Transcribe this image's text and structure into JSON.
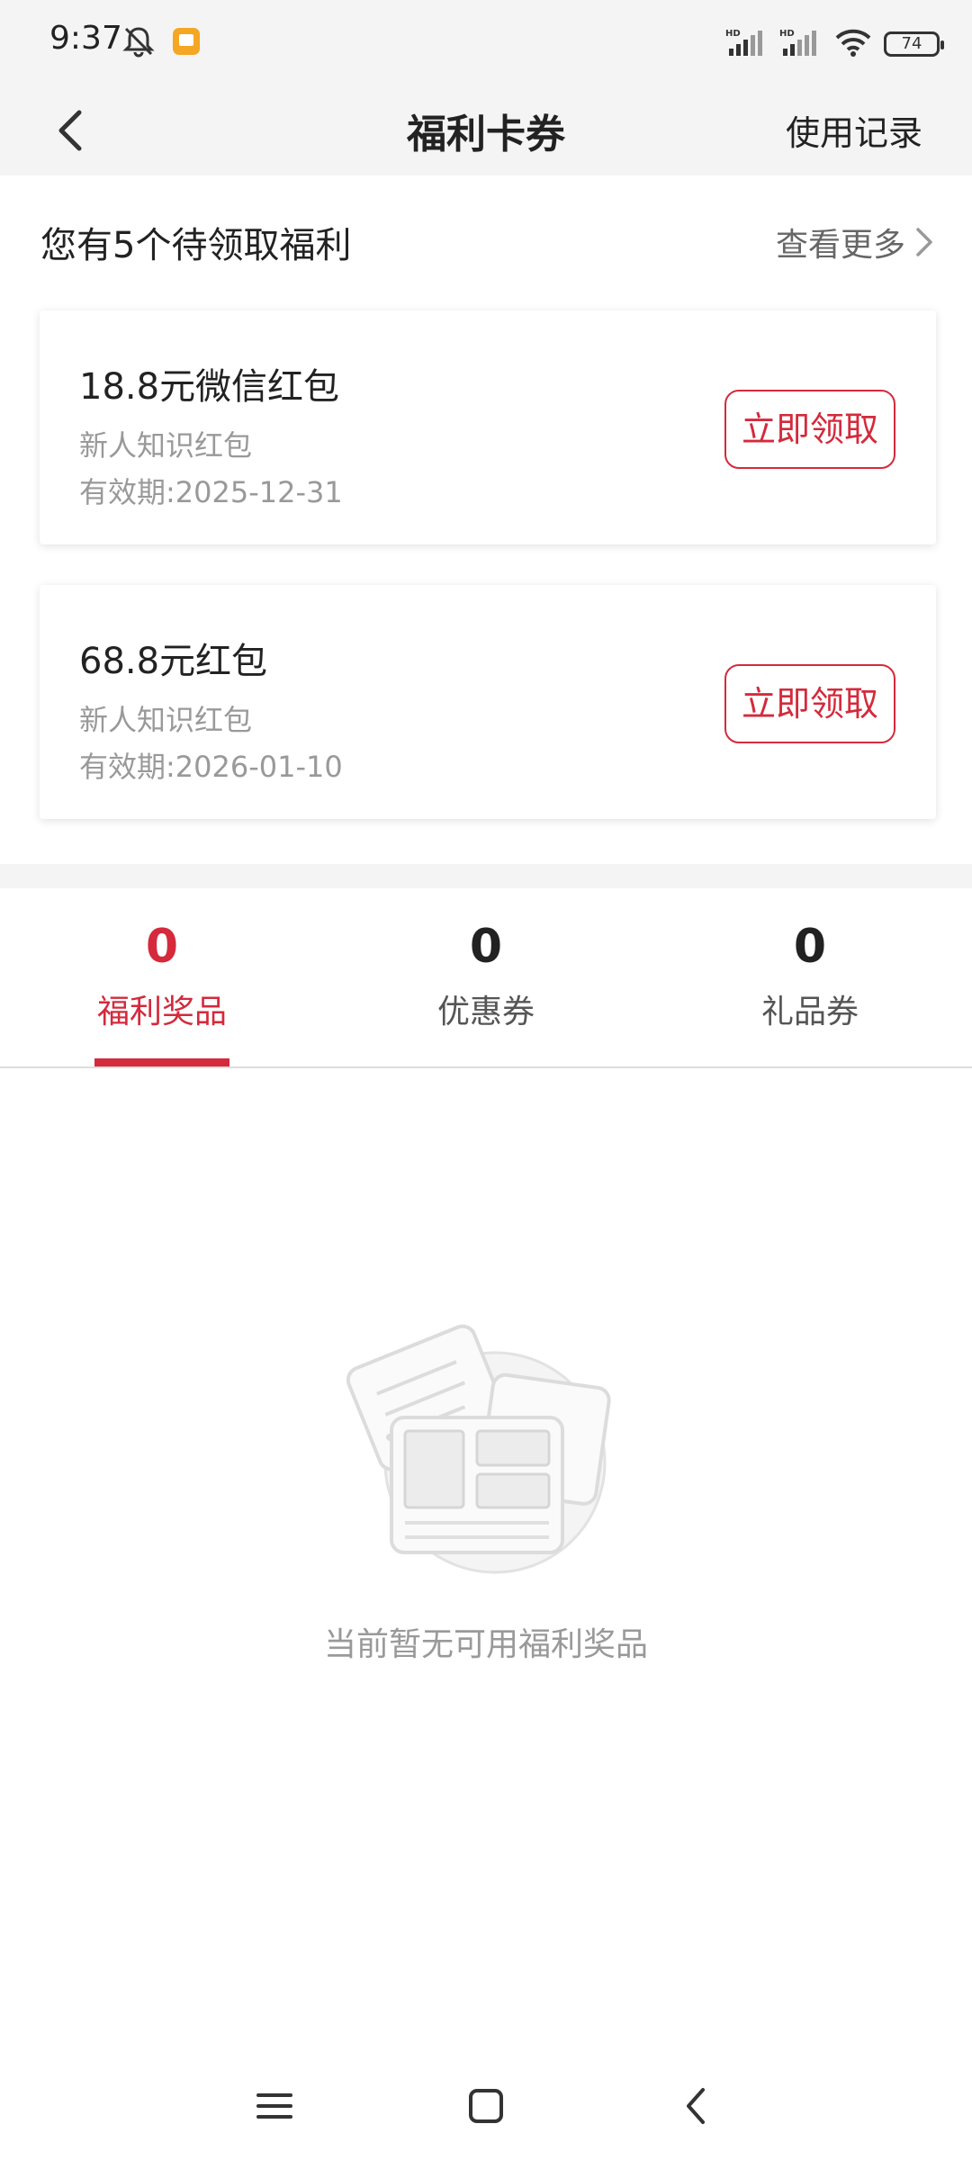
{
  "status_bar": {
    "time": "9:37",
    "battery": "74",
    "network_label": "HD"
  },
  "header": {
    "title": "福利卡券",
    "history_label": "使用记录"
  },
  "pending": {
    "title": "您有5个待领取福利",
    "more_label": "查看更多",
    "cards": [
      {
        "title": "18.8元微信红包",
        "subtitle": "新人知识红包",
        "expiry": "有效期:2025-12-31",
        "button": "立即领取"
      },
      {
        "title": "68.8元红包",
        "subtitle": "新人知识红包",
        "expiry": "有效期:2026-01-10",
        "button": "立即领取"
      }
    ]
  },
  "tabs": [
    {
      "count": "0",
      "label": "福利奖品",
      "active": true
    },
    {
      "count": "0",
      "label": "优惠券",
      "active": false
    },
    {
      "count": "0",
      "label": "礼品券",
      "active": false
    }
  ],
  "empty_state": {
    "message": "当前暂无可用福利奖品",
    "icon": "empty-coupon-illustration"
  },
  "nav": {
    "icons": [
      "menu-icon",
      "home-icon",
      "back-icon"
    ]
  },
  "colors": {
    "accent": "#d42a3c",
    "header_bg": "#f4f4f4",
    "text_primary": "#222222",
    "text_secondary": "#999999"
  }
}
